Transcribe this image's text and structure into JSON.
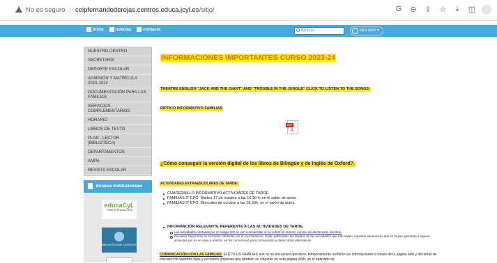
{
  "browser": {
    "security_label": "No es seguro",
    "url_host": "ceipfernandoderojas.centros.educa.jcyl.es",
    "url_path": "/sitio/",
    "toolbar_icons": [
      "google-g-icon",
      "zoom-icon",
      "share-icon",
      "star-icon",
      "download-icon",
      "sidebar-icon",
      "profile-icon"
    ],
    "toolbar_glyphs": [
      "G",
      "⊖",
      "⇪",
      "☆",
      "⤓",
      "◫"
    ]
  },
  "site_nav": {
    "links": [
      {
        "label": "Inicio",
        "icon": "home-icon"
      },
      {
        "label": "noticias",
        "icon": "news-icon"
      },
      {
        "label": "contacto",
        "icon": "mail-icon"
      }
    ],
    "search_placeholder": "Buscar",
    "web_link": "otra web ▾"
  },
  "sidebar": {
    "items": [
      "NUESTRO CENTRO",
      "SECRETARÍA",
      "DEPORTE ESCOLAR",
      "ADMISIÓN Y MATRÍCULA 2023-2024",
      "DOCUMENTACIÓN PARA LAS FAMILIAS",
      "SERVICIOS COMPLEMENTARIOS",
      "HORARIO",
      "LIBROS DE TEXTO",
      "PLAN - LECTOR (BIBLIOTECA)",
      "DEPARTAMENTOS",
      "AMPA",
      "REVISTA ESCOLAR"
    ],
    "enlaces_title": "Enlaces Institucionales",
    "educa_logo_text": "educaCyL",
    "educa_sub": "Portal de EDUCACIÓN",
    "biblio_text": "BIBLIOTECA de CENTROS"
  },
  "main": {
    "title": "INFORMACIONES IMPORTANTES CURSO 2023-24",
    "theatre": "THEATRE ENGLISH \"JACK AND THE GIANT\" AND \"TROUBLE IN THE JUNGLE\" CLICK TO LISTEN TO THE SONGS.",
    "diptico": "DÍPTICO INFORMATIVO FAMILIAS",
    "pdf_label": "PDF",
    "question": "¿Cómo conseguir la versión digital de los libros de Bilingüe y de Inglés de Oxford?.",
    "activities_title": "ACTIVIDADES EXTRAESCOLARES DE TARDE:",
    "activities": [
      "CUADERNILLO INFORMATIVO ACTIVIDADES DE TARDE",
      "FAMILIAS 2º EPO. Martes 17 de octubre a las 16.30 h. en el salón de actos.",
      "FAMILIAS 5º EPO. Miércoles de octubre a las 16.30h. en el salón de actos."
    ],
    "info_title": "INFORMACIÓN RELEVANTE REFERENTE A LAS ACTIVIDADES DE TARDE.",
    "info_sub": [
      "Las actividades ofertadas por el colegio NO se van a desarrollar si no cubren el número mínimo de alumnos/as inscritos.",
      "Escuelas Deportivas en el Centro ofertadas por el Ayuntamiento. Están publicados los listados de las actividades que han salido. Aquellos alumnos/as que se hayan apuntado a alguna actividad que no se vaya a realizar, se les comunicará para comunicarlo y darles otras alternativas."
    ],
    "comunicacion_lead": "COMUNICACIÓN CON LAS FAMILIAS:",
    "comunicacion_text": " El STYLUS FAMILIAS aún no se encuentra operativo, temporalmente recibirán las informaciones a través de la página web y del email de educacyl de vuestros hijos y circulares impresas que también se colgarán en esta página Web, en el apartado de"
  }
}
